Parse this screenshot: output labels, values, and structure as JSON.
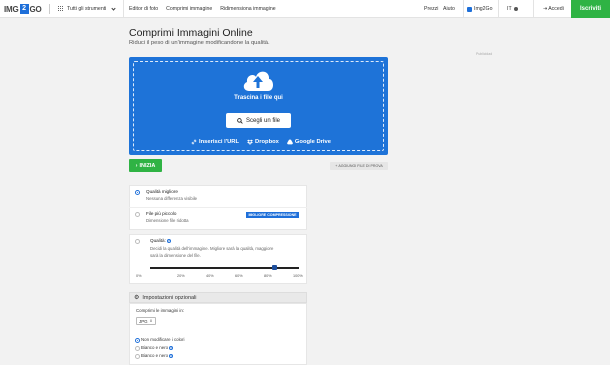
{
  "nav": {
    "logo_left": "IMG",
    "logo_mid": "2",
    "logo_right": "GO",
    "tools_label": "Tutti gli strumenti",
    "links": [
      "Editor di foto",
      "Comprimi immagine",
      "Ridimensiona immagine"
    ],
    "prices": "Prezzi",
    "help": "Aiuto",
    "brand": "Img2Go",
    "lang": "IT",
    "login": "Accedi",
    "signup": "Iscriviti"
  },
  "page": {
    "title": "Comprimi Immagini Online",
    "subtitle": "Riduci il peso di un'immagine modificandone la qualità.",
    "ad_label": "Publicidad"
  },
  "upload": {
    "drop_text": "Trascina i file qui",
    "choose_label": "Scegli un file",
    "sources": [
      "Inserisci l'URL",
      "Dropbox",
      "Google Drive"
    ]
  },
  "actions": {
    "start": "INIZIA",
    "add_sample": "AGGIUNGI FILE DI PROVA"
  },
  "options": {
    "best_quality_title": "Qualità migliore",
    "best_quality_desc": "Nessuna differenza visibile",
    "smaller_title": "File più piccolo",
    "smaller_desc": "Dimensione file ridotta",
    "badge": "MIGLIORE COMPRESSIONE",
    "quality_title": "Qualità:",
    "quality_desc_1": "Decidi la qualità dell'immagine. Migliore sarà la qualità, maggiore",
    "quality_desc_2": "sarà la dimensione del file.",
    "slider_value_percent": 85,
    "ticks": [
      "0%",
      "20%",
      "40%",
      "60%",
      "80%",
      "100%"
    ]
  },
  "optional": {
    "header": "Impostazioni opzionali",
    "compress_label": "Comprimi le immagini in:",
    "format_value": "JPG",
    "color_options": [
      "Non modificare i colori",
      "Bianco e nero",
      "Bianco e nero"
    ]
  },
  "colors": {
    "brand_blue": "#1e73d8",
    "green": "#2fb344"
  }
}
